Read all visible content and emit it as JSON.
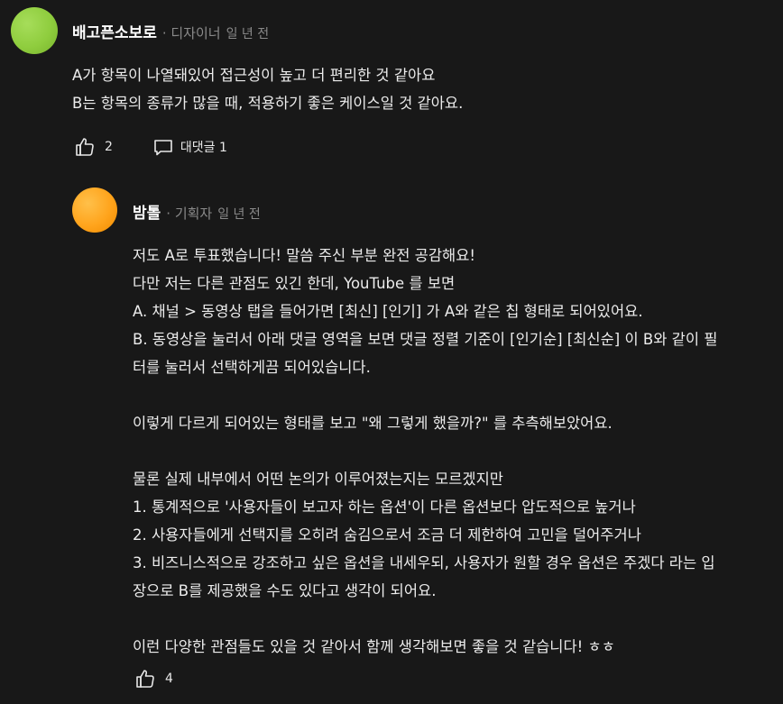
{
  "comment": {
    "author": "배고픈소보로",
    "role": "· 디자이너",
    "time": "일 년 전",
    "lines": [
      "A가 항목이 나열돼있어 접근성이 높고 더 편리한 것 같아요",
      "B는 항목의 종류가 많을 때, 적용하기 좋은 케이스일 것 같아요."
    ],
    "like_count": "2",
    "reply_label": "대댓글 1"
  },
  "reply": {
    "author": "밤톨",
    "role": "· 기획자",
    "time": "일 년 전",
    "lines": [
      "저도 A로 투표했습니다! 말씀 주신 부분 완전 공감해요!",
      "다만 저는 다른 관점도 있긴 한데, YouTube 를 보면",
      "A. 채널 > 동영상 탭을 들어가면 [최신] [인기] 가 A와 같은 칩 형태로 되어있어요.",
      "B. 동영상을 눌러서 아래 댓글 영역을 보면 댓글 정렬 기준이 [인기순] [최신순] 이 B와 같이 필",
      "터를 눌러서 선택하게끔 되어있습니다.",
      "",
      "이렇게 다르게 되어있는 형태를 보고 \"왜 그렇게 했을까?\" 를 추측해보았어요.",
      "",
      "물론 실제 내부에서 어떤 논의가 이루어졌는지는 모르겠지만",
      "1. 통계적으로 '사용자들이 보고자 하는 옵션'이 다른 옵션보다 압도적으로 높거나",
      "2. 사용자들에게 선택지를 오히려 숨김으로서 조금 더 제한하여 고민을 덜어주거나",
      "3. 비즈니스적으로 강조하고 싶은 옵션을 내세우되, 사용자가 원할 경우 옵션은 주겠다 라는 입",
      "장으로 B를 제공했을 수도 있다고 생각이 되어요.",
      "",
      "이런 다양한 관점들도 있을 것 같아서 함께 생각해보면 좋을 것 같습니다! ㅎㅎ"
    ],
    "like_count": "4"
  }
}
